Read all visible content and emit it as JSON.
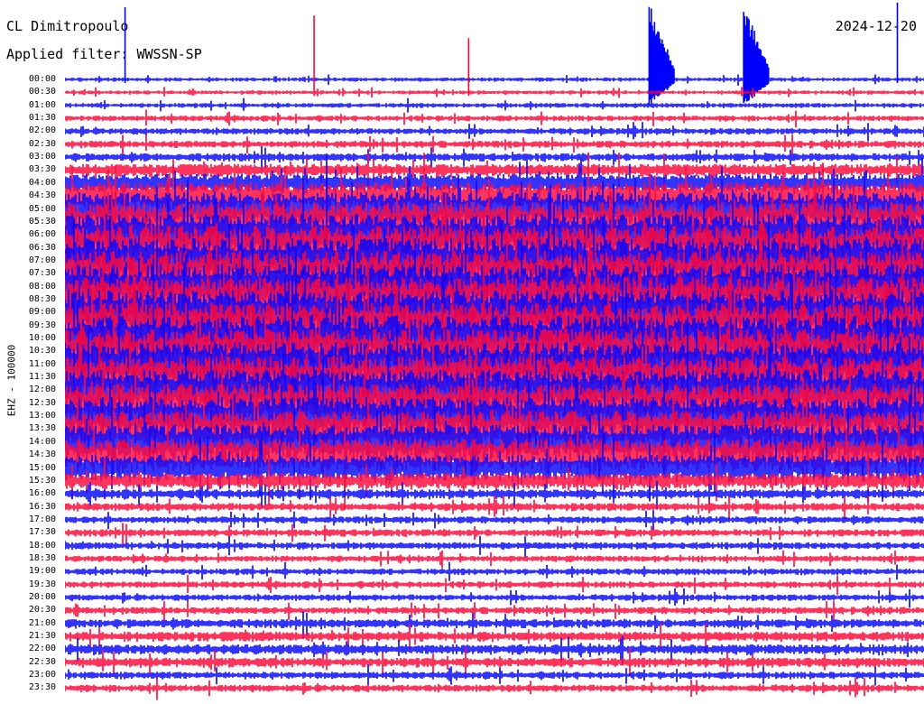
{
  "header": {
    "station": "CL Dimitropoulo",
    "filter": "Applied filter: WWSSN-SP",
    "date": "2024-12-20",
    "channel": "EHZ - 100000"
  },
  "colors": {
    "trace_a": "#0000ff",
    "trace_b": "#ff0033",
    "background": "#ffffff"
  },
  "chart_data": {
    "type": "line",
    "title": "",
    "xlabel": "",
    "ylabel": "EHZ - 100000",
    "grid": false,
    "legend": "none",
    "categories": [
      "00:00",
      "00:30",
      "01:00",
      "01:30",
      "02:00",
      "02:30",
      "03:00",
      "03:30",
      "04:00",
      "04:30",
      "05:00",
      "05:30",
      "06:00",
      "06:30",
      "07:00",
      "07:30",
      "08:00",
      "08:30",
      "09:00",
      "09:30",
      "10:00",
      "10:30",
      "11:00",
      "11:30",
      "12:00",
      "12:30",
      "13:00",
      "13:30",
      "14:00",
      "14:30",
      "15:00",
      "15:30",
      "16:00",
      "16:30",
      "17:00",
      "17:30",
      "18:00",
      "18:30",
      "19:00",
      "19:30",
      "20:00",
      "20:30",
      "21:00",
      "21:30",
      "22:00",
      "22:30",
      "23:00",
      "23:30"
    ],
    "row_colors": [
      "trace_a",
      "trace_b"
    ],
    "relative_amplitude": [
      0.25,
      0.25,
      0.3,
      0.35,
      0.4,
      0.45,
      0.5,
      0.8,
      1.2,
      1.8,
      2.2,
      2.6,
      2.8,
      2.9,
      3.0,
      3.0,
      3.0,
      3.0,
      3.0,
      3.0,
      3.0,
      3.0,
      2.9,
      2.8,
      2.7,
      2.6,
      2.5,
      2.4,
      2.3,
      2.1,
      1.7,
      1.0,
      0.6,
      0.5,
      0.45,
      0.45,
      0.45,
      0.4,
      0.4,
      0.4,
      0.4,
      0.45,
      0.55,
      0.6,
      0.65,
      0.6,
      0.45,
      0.45
    ],
    "events": [
      {
        "row": 0,
        "x_fraction": 0.07,
        "height": 80
      },
      {
        "row": 1,
        "x_fraction": 0.29,
        "height": 85
      },
      {
        "row": 1,
        "x_fraction": 0.47,
        "height": 60
      },
      {
        "row": 0,
        "x_fraction": 0.68,
        "height": 85,
        "burst": true
      },
      {
        "row": 0,
        "x_fraction": 0.79,
        "height": 85,
        "burst": true
      },
      {
        "row": 0,
        "x_fraction": 0.969,
        "height": 85
      }
    ]
  }
}
